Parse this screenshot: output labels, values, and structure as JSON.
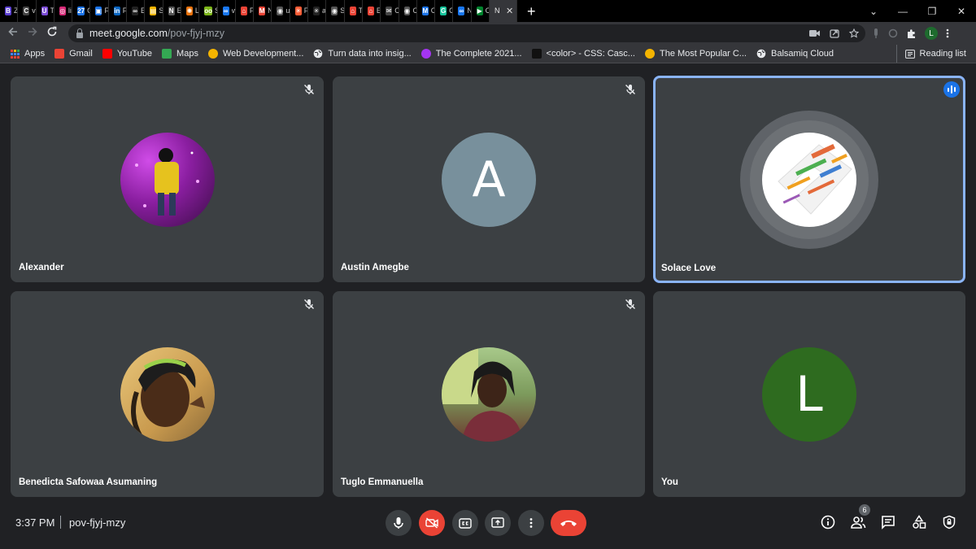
{
  "tabs": [
    {
      "letter": "B",
      "title": "Z",
      "color": "#5b3fd3"
    },
    {
      "letter": "C",
      "title": "v",
      "color": "#444"
    },
    {
      "letter": "U",
      "title": "T",
      "color": "#7b4bd6"
    },
    {
      "letter": "◎",
      "title": "li",
      "color": "#d62976"
    },
    {
      "letter": "27",
      "title": "C",
      "color": "#1a73e8"
    },
    {
      "letter": "▣",
      "title": "F",
      "color": "#1a73e8"
    },
    {
      "letter": "in",
      "title": "F",
      "color": "#0a66c2"
    },
    {
      "letter": "∞",
      "title": "E",
      "color": "#222"
    },
    {
      "letter": "▤",
      "title": "S",
      "color": "#f4b400"
    },
    {
      "letter": "N",
      "title": "E",
      "color": "#555"
    },
    {
      "letter": "✺",
      "title": "L",
      "color": "#e8710a"
    },
    {
      "letter": "oo",
      "title": "S",
      "color": "#7cb518"
    },
    {
      "letter": "∞",
      "title": "v",
      "color": "#1877f2"
    },
    {
      "letter": "⌂",
      "title": "F",
      "color": "#ea4335"
    },
    {
      "letter": "M",
      "title": "N",
      "color": "#ea4335"
    },
    {
      "letter": "◉",
      "title": "u",
      "color": "#555"
    },
    {
      "letter": "✳",
      "title": "F",
      "color": "#ff5c35"
    },
    {
      "letter": "✳",
      "title": "a",
      "color": "#222"
    },
    {
      "letter": "◉",
      "title": "S",
      "color": "#555"
    },
    {
      "letter": "⌂",
      "title": "T",
      "color": "#ea4335"
    },
    {
      "letter": "⌂",
      "title": "E",
      "color": "#ea4335"
    },
    {
      "letter": "✉",
      "title": "C",
      "color": "#444"
    },
    {
      "letter": "◉",
      "title": "C",
      "color": "#555"
    },
    {
      "letter": "M",
      "title": "C",
      "color": "#1a73e8"
    },
    {
      "letter": "G",
      "title": "C",
      "color": "#15c39a"
    },
    {
      "letter": "∞",
      "title": "N",
      "color": "#1877f2"
    },
    {
      "letter": "▶",
      "title": "C",
      "color": "#00832d"
    }
  ],
  "active_tab": {
    "title": "N",
    "close": "✕"
  },
  "new_tab_label": "+",
  "window_controls": {
    "chevron": "⌄",
    "minimize": "—",
    "restore": "❐",
    "close": "✕"
  },
  "omnibox": {
    "host": "meet.google.com",
    "path": "/pov-fjyj-mzy"
  },
  "profile_initial": "L",
  "bookmarks": [
    {
      "label": "Apps",
      "icon": "apps-grid-icon",
      "color": "#e8eaed"
    },
    {
      "label": "Gmail",
      "icon": "gmail-icon",
      "color": "#ea4335"
    },
    {
      "label": "YouTube",
      "icon": "youtube-icon",
      "color": "#ff0000"
    },
    {
      "label": "Maps",
      "icon": "maps-icon",
      "color": "#34a853"
    },
    {
      "label": "Web Development...",
      "icon": "bookmark-favicon-icon",
      "color": "#f4b400"
    },
    {
      "label": "Turn data into insig...",
      "icon": "globe-icon",
      "color": "#e8eaed"
    },
    {
      "label": "The Complete 2021...",
      "icon": "udemy-icon",
      "color": "#a435f0"
    },
    {
      "label": "<color> - CSS: Casc...",
      "icon": "mdn-icon",
      "color": "#111"
    },
    {
      "label": "The Most Popular C...",
      "icon": "bookmark-favicon-icon",
      "color": "#f4b400"
    },
    {
      "label": "Balsamiq Cloud",
      "icon": "globe-icon",
      "color": "#e8eaed"
    }
  ],
  "reading_list": "Reading list",
  "participants": [
    {
      "name": "Alexander",
      "muted": true,
      "speaking": false,
      "avatar_type": "photo",
      "photo_colors": [
        "#7a1f8a",
        "#c13be0",
        "#2a0a33"
      ]
    },
    {
      "name": "Austin Amegbe",
      "muted": true,
      "speaking": false,
      "avatar_type": "letter",
      "letter": "A",
      "bg": "#78909c"
    },
    {
      "name": "Solace Love",
      "muted": false,
      "speaking": true,
      "avatar_type": "wordcloud",
      "photo_colors": [
        "#ffffff",
        "#e36a3a",
        "#4caf50"
      ]
    },
    {
      "name": "Benedicta Safowaa Asumaning",
      "muted": true,
      "speaking": false,
      "avatar_type": "photo",
      "photo_colors": [
        "#d9b36a",
        "#5c3a22",
        "#2b1a10"
      ]
    },
    {
      "name": "Tuglo Emmanuella",
      "muted": true,
      "speaking": false,
      "avatar_type": "photo",
      "photo_colors": [
        "#8fb86b",
        "#7a3b2e",
        "#4a2a26"
      ]
    },
    {
      "name": "You",
      "muted": false,
      "speaking": false,
      "avatar_type": "letter",
      "letter": "L",
      "bg": "#2e6b1f"
    }
  ],
  "bottom": {
    "time": "3:37 PM",
    "meeting_code": "pov-fjyj-mzy",
    "people_count": "6"
  }
}
